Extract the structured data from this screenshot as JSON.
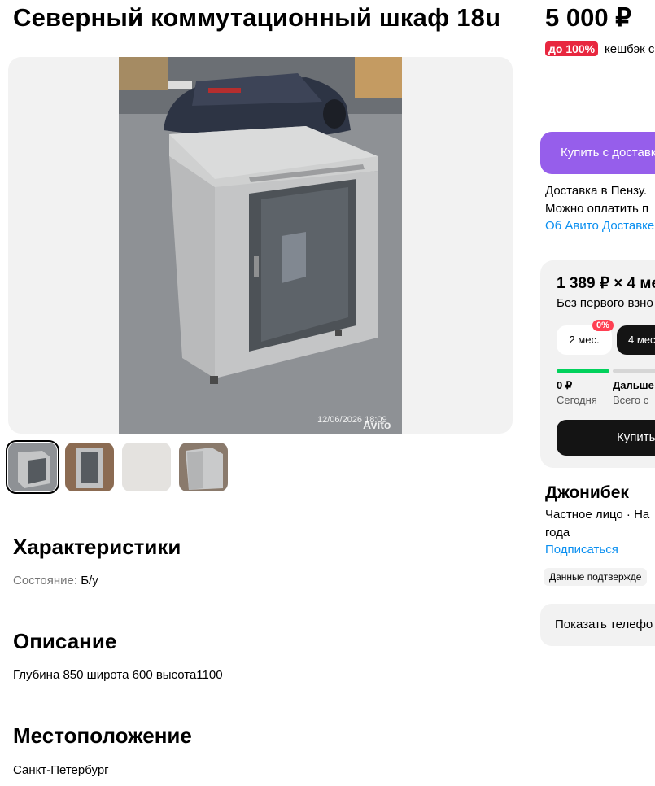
{
  "listing": {
    "title": "Северный коммутационный шкаф 18u",
    "price": "5 000 ₽",
    "cashback_badge": "до 100%",
    "cashback_text": "кешбэк с"
  },
  "gallery": {
    "photo_timestamp": "12/06/2026 18:09",
    "photo_watermark": "Avito",
    "thumbnails_count": 4,
    "active_thumbnail": 1
  },
  "specs": {
    "heading": "Характеристики",
    "condition_label": "Состояние:",
    "condition_value": "Б/у"
  },
  "description": {
    "heading": "Описание",
    "text": "Глубина 850 широта 600 высота1100"
  },
  "location": {
    "heading": "Местоположение",
    "city": "Санкт-Петербург"
  },
  "delivery": {
    "buy_button": "Купить с доставк",
    "line1": "Доставка в Пензу.",
    "line2": "Можно оплатить п",
    "link": "Об Авито Доставке"
  },
  "installment": {
    "amount": "1 389 ₽ × 4 ме",
    "subtitle": "Без первого взно",
    "option1": "2 мес.",
    "option2": "4 мес",
    "discount_badge": "0%",
    "today_amount": "0 ₽",
    "today_label": "Сегодня",
    "later_amount": "Дальше",
    "later_label": "Всего с",
    "buy_button": "Купить"
  },
  "seller": {
    "name": "Джонибек",
    "type_line": "Частное лицо · На",
    "since_line": "года",
    "subscribe_link": "Подписаться",
    "verified_badge": "Данные подтвержде",
    "phone_button": "Показать телефо"
  },
  "colors": {
    "accent_purple": "#965eeb",
    "link_blue": "#0a8ff0",
    "badge_red": "#e8273f",
    "progress_green": "#02d15c"
  }
}
